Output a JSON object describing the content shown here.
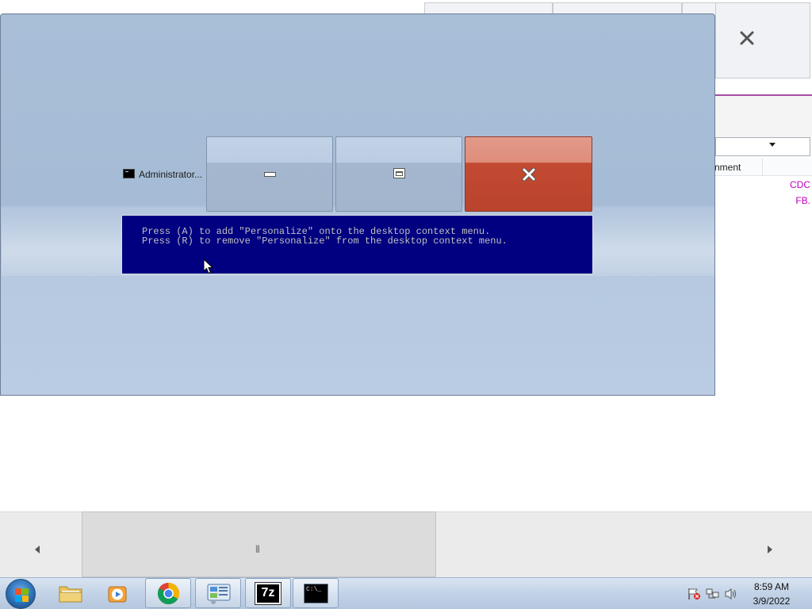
{
  "background_window": {
    "column_header": "nment",
    "cells": [
      "CDC",
      "FB."
    ]
  },
  "peek": {
    "window_title": "Administrator...",
    "console_lines": [
      "Press (A) to add \"Personalize\" onto the desktop context menu.",
      "Press (R) to remove \"Personalize\" from the desktop context menu."
    ],
    "buttons": {
      "minimize": "minimize-icon",
      "maximize": "maximize-icon",
      "close": "close-icon"
    }
  },
  "taskbar": {
    "items": [
      {
        "name": "windows-explorer",
        "icon": "folder-icon"
      },
      {
        "name": "windows-media-player",
        "icon": "media-player-icon"
      },
      {
        "name": "google-chrome",
        "icon": "chrome-icon"
      },
      {
        "name": "control-panel",
        "icon": "control-panel-icon"
      },
      {
        "name": "7-zip",
        "icon": "7zip-icon",
        "label": "7z"
      },
      {
        "name": "command-prompt",
        "icon": "cmd-icon",
        "label": "C:\\_"
      }
    ],
    "tray": {
      "time": "8:59 AM",
      "date": "3/9/2022"
    }
  },
  "colors": {
    "console_bg": "#000080",
    "close_red": "#c34a32",
    "peek_blue": "#a9bfd8",
    "cell_magenta": "#c000c0"
  }
}
